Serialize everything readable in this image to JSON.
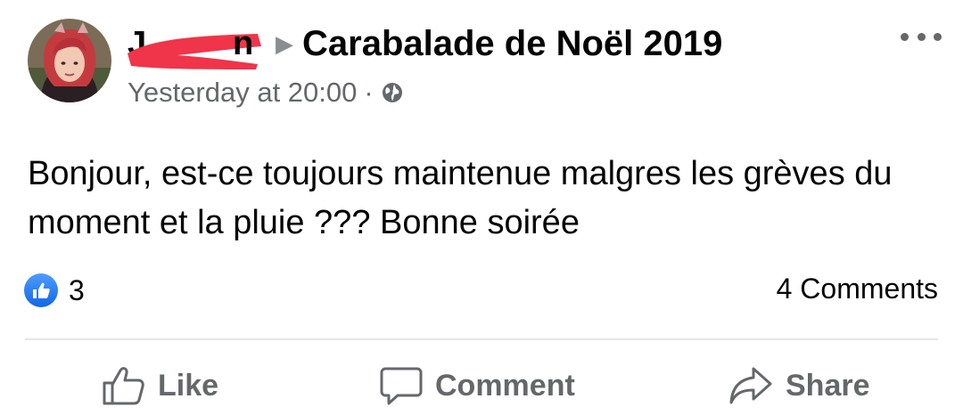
{
  "post": {
    "author_visible_start": "J",
    "author_visible_end": "n",
    "group_name": "Carabalade de Noël 2019",
    "timestamp": "Yesterday at 20:00",
    "separator": "·",
    "privacy_icon": "globe-icon",
    "body": "Bonjour, est-ce toujours maintenue malgres les grèves du moment et la pluie ??? Bonne soirée"
  },
  "reactions": {
    "icon": "like-icon",
    "count": "3"
  },
  "comments": {
    "label": "4 Comments"
  },
  "actions": {
    "like": "Like",
    "comment": "Comment",
    "share": "Share"
  },
  "colors": {
    "secondary_text": "#65676b",
    "like_blue": "#1877f2",
    "redaction": "#f0344a"
  }
}
